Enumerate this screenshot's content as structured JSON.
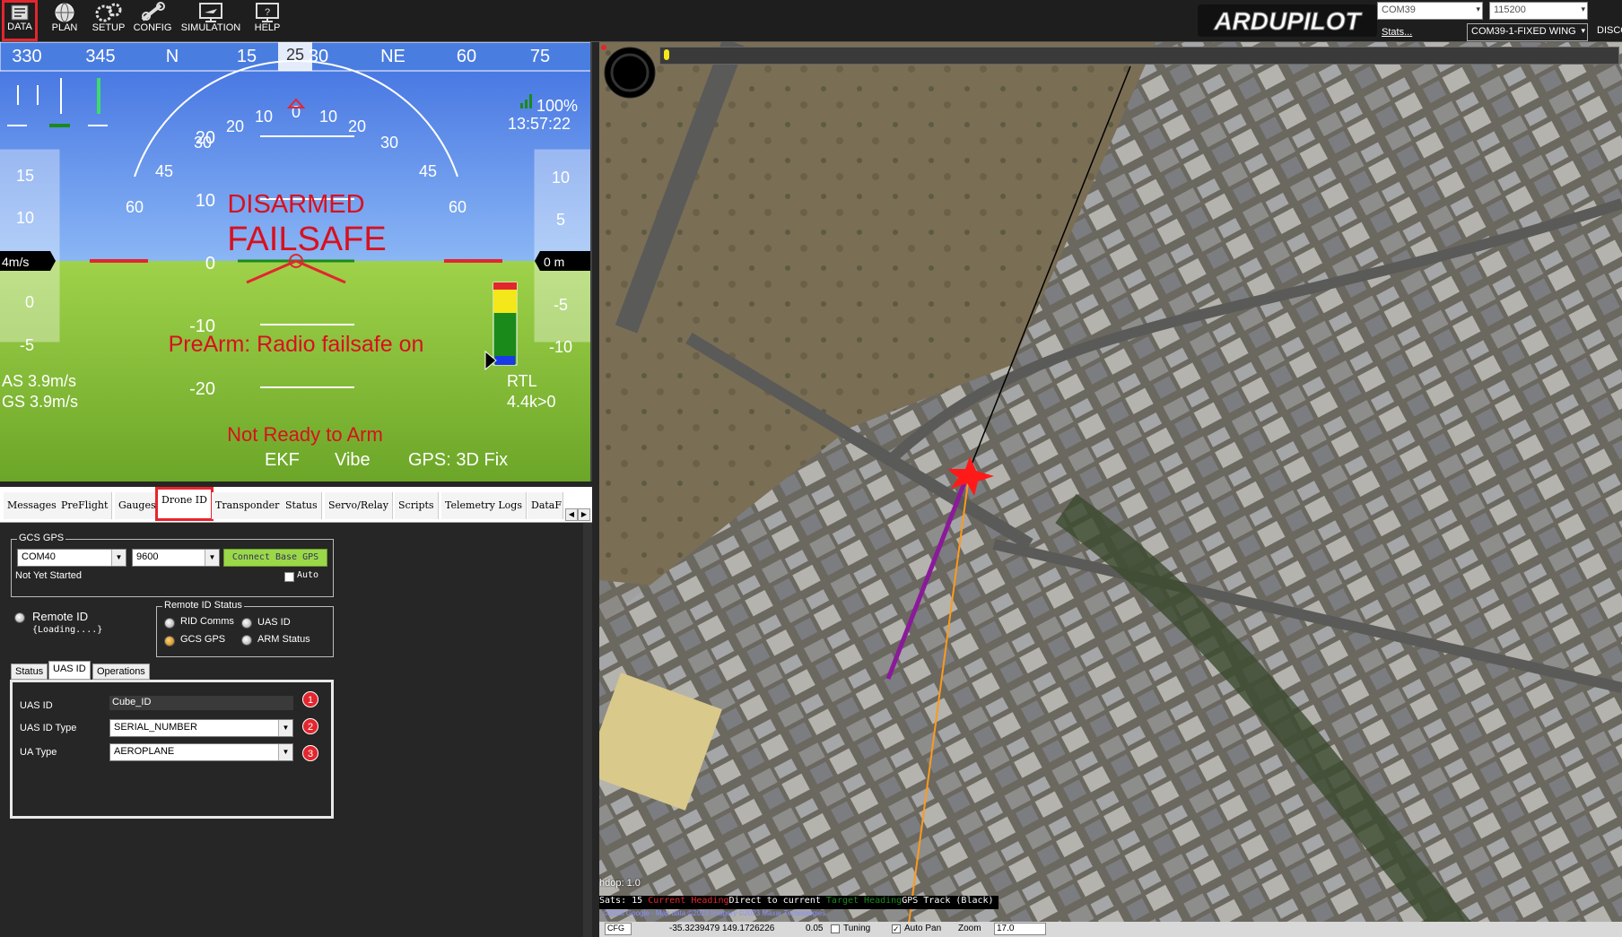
{
  "toolbar": {
    "buttons": [
      {
        "label": "DATA",
        "icon": "data-icon",
        "active": true
      },
      {
        "label": "PLAN",
        "icon": "globe-icon"
      },
      {
        "label": "SETUP",
        "icon": "gears-icon"
      },
      {
        "label": "CONFIG",
        "icon": "wrench-icon"
      },
      {
        "label": "SIMULATION",
        "icon": "monitor-plane-icon"
      },
      {
        "label": "HELP",
        "icon": "monitor-help-icon"
      }
    ],
    "logo_text": "ARDUPILOT",
    "port": "COM39",
    "baud": "115200",
    "stats_link": "Stats...",
    "vehicle": "COM39-1-FIXED WING",
    "disconnect_label": "DISCO"
  },
  "hud": {
    "heading_ticks": [
      "330",
      "345",
      "N",
      "15",
      "25",
      "30",
      "NE",
      "60",
      "75"
    ],
    "heading_value": "25",
    "roll_labels": [
      "60",
      "45",
      "30",
      "20",
      "10",
      "0",
      "10",
      "20",
      "30",
      "45",
      "60"
    ],
    "pitch_labels": [
      "20",
      "10",
      "0",
      "-10",
      "-20"
    ],
    "speed_scale": [
      "15",
      "10",
      "5",
      "0",
      "-5"
    ],
    "speed_value": "4m/s",
    "alt_scale": [
      "10",
      "5",
      "-5",
      "-10"
    ],
    "alt_value": "0 m",
    "battery_percent": "100%",
    "time": "13:57:22",
    "disarmed": "DISARMED",
    "failsafe": "FAILSAFE",
    "prearm": "PreArm: Radio failsafe on",
    "airspeed": "AS 3.9m/s",
    "groundspeed": "GS 3.9m/s",
    "mode": "RTL",
    "wp_info": "4.4k>0",
    "not_ready": "Not Ready to Arm",
    "ekf": "EKF",
    "vibe": "Vibe",
    "gps": "GPS: 3D Fix"
  },
  "tabs": [
    "Messages",
    "PreFlight",
    "Gauges",
    "Drone ID",
    "Transponder",
    "Status",
    "Servo/Relay",
    "Scripts",
    "Telemetry Logs",
    "DataF"
  ],
  "active_tab": "Drone ID",
  "drone_id": {
    "gcs_gps_label": "GCS GPS",
    "gcs_port": "COM40",
    "gcs_baud": "9600",
    "connect_label": "Connect Base GPS",
    "auto_label": "Auto",
    "not_started": "Not Yet Started",
    "remote_id_label": "Remote ID",
    "remote_id_sub": "{Loading....}",
    "status_group_label": "Remote ID Status",
    "status_items": [
      "RID Comms",
      "UAS ID",
      "GCS GPS",
      "ARM Status"
    ],
    "inner_tabs": [
      "Status",
      "UAS ID",
      "Operations"
    ],
    "inner_active": "UAS ID",
    "fields": [
      {
        "label": "UAS ID",
        "value": "Cube_ID",
        "badge": "1"
      },
      {
        "label": "UAS ID Type",
        "value": "SERIAL_NUMBER",
        "badge": "2"
      },
      {
        "label": "UA Type",
        "value": "AEROPLANE",
        "badge": "3"
      }
    ]
  },
  "map": {
    "hdop": "hdop: 1.0",
    "sats": "Sats: 15",
    "legend": [
      {
        "text": "Current Heading",
        "color": "#e3262e"
      },
      {
        "text": "Direct to current",
        "color": "#000000"
      },
      {
        "text": "Target Heading",
        "color": "#1a8a1a"
      },
      {
        "text": "GPS Track (Black)",
        "color": "#000000"
      }
    ],
    "copyright": "©2023 Google - Map data ©2023 Imagery ©2023 Maxar Technologies",
    "status_mode": "CFG",
    "coords": "-35.3239479 149.1726226",
    "dist": "0.05",
    "tuning_label": "Tuning",
    "autopan_label": "Auto Pan",
    "zoom_label": "Zoom",
    "zoom_value": "17.0"
  },
  "colors": {
    "accent_red": "#e3262e",
    "sky": "#4f86e8",
    "ground": "#8fc63a",
    "purple_track": "#8a1a9a",
    "orange_line": "#ff9a1a"
  }
}
